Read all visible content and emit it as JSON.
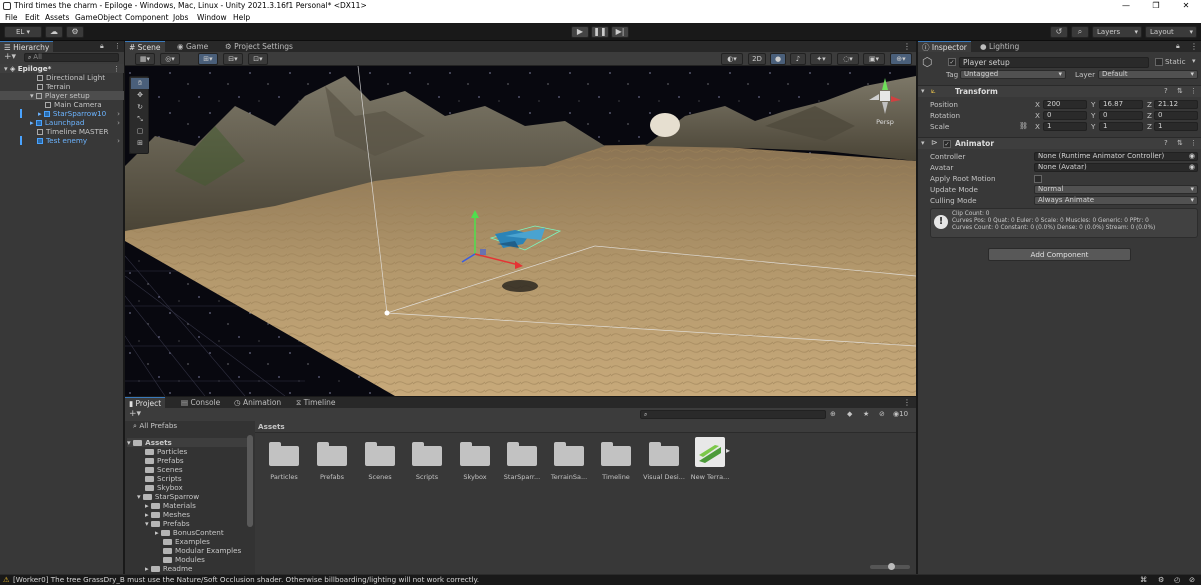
{
  "window": {
    "title": "Third times the charm - Epiloge - Windows, Mac, Linux - Unity 2021.3.16f1 Personal* <DX11>",
    "controls": [
      "—",
      "❐",
      "✕"
    ]
  },
  "menu": [
    "File",
    "Edit",
    "Assets",
    "GameObject",
    "Component",
    "Jobs",
    "Window",
    "Help"
  ],
  "toolbar": {
    "account": "EL ▾",
    "layers": "Layers",
    "layout": "Layout"
  },
  "hierarchy": {
    "tab": "Hierarchy",
    "search_placeholder": "All",
    "scene": "Epiloge*",
    "items": [
      {
        "label": "Directional Light"
      },
      {
        "label": "Terrain"
      },
      {
        "label": "Player setup"
      },
      {
        "label": "Main Camera"
      },
      {
        "label": "StarSparrow10"
      },
      {
        "label": "Launchpad"
      },
      {
        "label": "Timeline MASTER"
      },
      {
        "label": "Test enemy"
      }
    ]
  },
  "scene_tabs": [
    "Scene",
    "Game",
    "Project Settings"
  ],
  "scene_tools": {
    "mode_2d": "2D",
    "persp": "Persp"
  },
  "project": {
    "tabs": [
      "Project",
      "Console",
      "Animation",
      "Timeline"
    ],
    "favorites": "All Prefabs",
    "breadcrumb": "Assets",
    "tree": [
      {
        "label": "Assets",
        "indent": 0,
        "open": true
      },
      {
        "label": "Particles",
        "indent": 1
      },
      {
        "label": "Prefabs",
        "indent": 1
      },
      {
        "label": "Scenes",
        "indent": 1
      },
      {
        "label": "Scripts",
        "indent": 1
      },
      {
        "label": "Skybox",
        "indent": 1
      },
      {
        "label": "StarSparrow",
        "indent": 1,
        "open": true
      },
      {
        "label": "Materials",
        "indent": 2
      },
      {
        "label": "Meshes",
        "indent": 2
      },
      {
        "label": "Prefabs",
        "indent": 2,
        "open": true
      },
      {
        "label": "BonusContent",
        "indent": 3
      },
      {
        "label": "Examples",
        "indent": 3
      },
      {
        "label": "Modular Examples",
        "indent": 3
      },
      {
        "label": "Modules",
        "indent": 3
      },
      {
        "label": "Readme",
        "indent": 2
      }
    ],
    "assets": [
      "Particles",
      "Prefabs",
      "Scenes",
      "Scripts",
      "Skybox",
      "StarSparr...",
      "TerrainSa...",
      "Timeline",
      "Visual Desi...",
      "New Terra..."
    ],
    "hidden_count": "10"
  },
  "inspector": {
    "tabs": [
      "Inspector",
      "Lighting"
    ],
    "object_name": "Player setup",
    "static": "Static",
    "tag_label": "Tag",
    "tag_value": "Untagged",
    "layer_label": "Layer",
    "layer_value": "Default",
    "transform": {
      "title": "Transform",
      "rows": [
        {
          "label": "Position",
          "x": "200",
          "y": "16.87",
          "z": "21.12"
        },
        {
          "label": "Rotation",
          "x": "0",
          "y": "0",
          "z": "0"
        },
        {
          "label": "Scale",
          "x": "1",
          "y": "1",
          "z": "1"
        }
      ]
    },
    "animator": {
      "title": "Animator",
      "controller_label": "Controller",
      "controller_value": "None (Runtime Animator Controller)",
      "avatar_label": "Avatar",
      "avatar_value": "None (Avatar)",
      "root_motion_label": "Apply Root Motion",
      "update_label": "Update Mode",
      "update_value": "Normal",
      "culling_label": "Culling Mode",
      "culling_value": "Always Animate",
      "info": [
        "Clip Count: 0",
        "Curves Pos: 0 Quat: 0 Euler: 0 Scale: 0 Muscles: 0 Generic: 0 PPtr: 0",
        "Curves Count: 0 Constant: 0 (0.0%) Dense: 0 (0.0%) Stream: 0 (0.0%)"
      ]
    },
    "add_component": "Add Component"
  },
  "status": {
    "message": "[Worker0] The tree GrassDry_B must use the Nature/Soft Occlusion shader. Otherwise billboarding/lighting will not work correctly."
  },
  "colors": {
    "accent": "#3a79bb",
    "prefab_blue": "#4aa3ff",
    "warning": "#f2c12e"
  }
}
